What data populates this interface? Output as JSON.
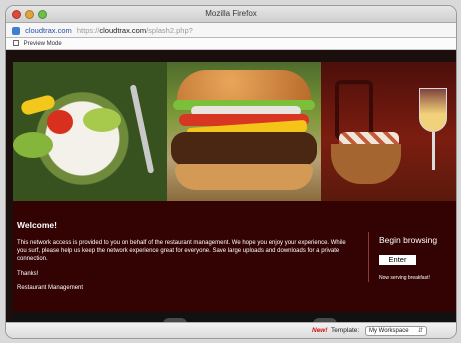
{
  "window": {
    "title": "Mozilla Firefox"
  },
  "urlbar": {
    "site_badge": "cloudtrax.com",
    "protocol": "https://",
    "domain": "cloudtrax.com",
    "path": "/splash2.php?"
  },
  "preview": {
    "label": "Preview Mode"
  },
  "welcome": {
    "title": "Welcome!",
    "body": "This network access is provided to you on behalf of the restaurant management. We hope you enjoy your experience. While you surf, please help us keep the network experience great for everyone. Save large uploads and downloads for a private connection.",
    "thanks": "Thanks!",
    "signature": "Restaurant Management"
  },
  "browse": {
    "title": "Begin browsing",
    "enter_label": "Enter",
    "serving": "Now serving breakfast!"
  },
  "status": {
    "new_label": "New!",
    "template_label": "Template:",
    "template_value": "My Workspace"
  }
}
